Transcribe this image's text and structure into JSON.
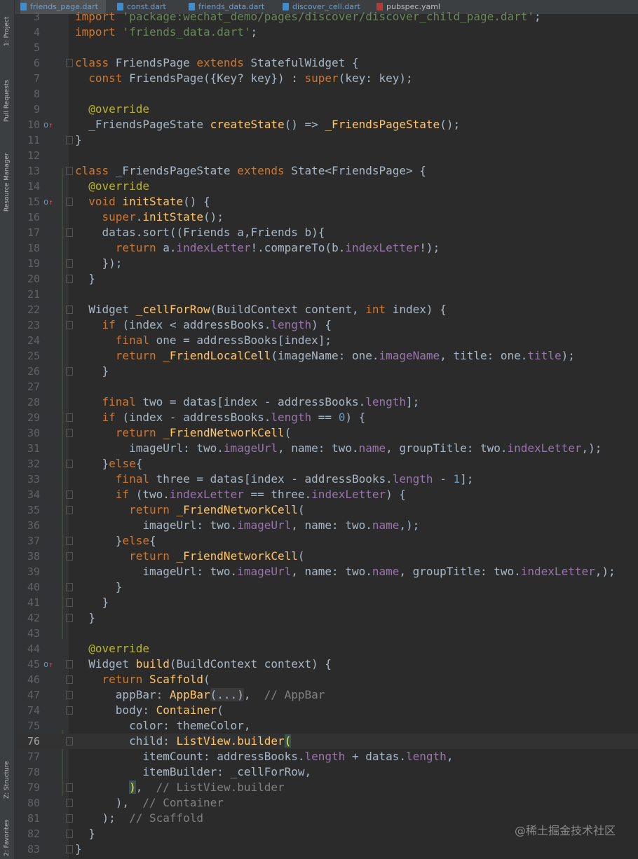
{
  "tabs": [
    {
      "label": "friends_page.dart"
    },
    {
      "label": "const.dart"
    },
    {
      "label": "friends_data.dart"
    },
    {
      "label": "discover_cell.dart"
    },
    {
      "label": "pubspec.yaml"
    }
  ],
  "sidebar": {
    "project": "1: Project",
    "pull_requests": "Pull Requests",
    "resource_manager": "Resource Manager",
    "structure": "Z: Structure",
    "favorites": "2: Favorites"
  },
  "current_line": "76",
  "watermark": "@稀土掘金技术社区",
  "colors": {
    "keyword": "#cc7832",
    "string": "#6a8759",
    "function": "#ffc66d",
    "annotation": "#bbb529",
    "property": "#9876aa",
    "number": "#6897bb",
    "comment": "#808080"
  },
  "lines": [
    {
      "n": "3",
      "html": "<span class=\"kw\">import </span><span class=\"str\">'package:wechat_demo/pages/discover/discover_child_page.dart'</span>;",
      "fold": false,
      "mark": false
    },
    {
      "n": "4",
      "html": "<span class=\"kw\">import </span><span class=\"str\">'friends_data.dart'</span>;",
      "fold": false,
      "mark": false
    },
    {
      "n": "5",
      "html": "",
      "fold": false,
      "mark": false
    },
    {
      "n": "6",
      "html": "<span class=\"kw\">class </span>FriendsPage <span class=\"kw\">extends </span>StatefulWidget {",
      "fold": true,
      "mark": false
    },
    {
      "n": "7",
      "html": "  <span class=\"kw\">const </span>FriendsPage({Key? key}) : <span class=\"kw\">super</span>(key: key);",
      "fold": false,
      "mark": false
    },
    {
      "n": "8",
      "html": "",
      "fold": false,
      "mark": false
    },
    {
      "n": "9",
      "html": "  <span class=\"ann\">@override</span>",
      "fold": false,
      "mark": false
    },
    {
      "n": "10",
      "html": "  _FriendsPageState <span class=\"fn\">createState</span>() =&gt; <span class=\"fn\">_FriendsPageState</span>();",
      "fold": false,
      "mark": true
    },
    {
      "n": "11",
      "html": "}",
      "fold": true,
      "mark": false
    },
    {
      "n": "12",
      "html": "",
      "fold": false,
      "mark": false
    },
    {
      "n": "13",
      "html": "<span class=\"kw\">class </span>_FriendsPageState <span class=\"kw\">extends </span>State&lt;FriendsPage&gt; {",
      "fold": true,
      "mark": false
    },
    {
      "n": "14",
      "html": "  <span class=\"ann\">@override</span>",
      "fold": false,
      "mark": false
    },
    {
      "n": "15",
      "html": "  <span class=\"kw\">void </span><span class=\"fn\">initState</span>() {",
      "fold": true,
      "mark": true
    },
    {
      "n": "16",
      "html": "    <span class=\"kw\">super</span>.<span class=\"fn\">initState</span>();",
      "fold": false,
      "mark": false
    },
    {
      "n": "17",
      "html": "    datas.sort((Friends a,Friends b){",
      "fold": true,
      "mark": false
    },
    {
      "n": "18",
      "html": "      <span class=\"kw\">return </span>a.<span class=\"prop\">indexLetter</span>!.compareTo(b.<span class=\"prop\">indexLetter</span>!);",
      "fold": false,
      "mark": false
    },
    {
      "n": "19",
      "html": "    });",
      "fold": true,
      "mark": false
    },
    {
      "n": "20",
      "html": "  }",
      "fold": true,
      "mark": false
    },
    {
      "n": "21",
      "html": "",
      "fold": false,
      "mark": false
    },
    {
      "n": "22",
      "html": "  Widget <span class=\"fn\">_cellForRow</span>(BuildContext content, <span class=\"kw\">int </span>index) {",
      "fold": true,
      "mark": false
    },
    {
      "n": "23",
      "html": "    <span class=\"kw\">if </span>(index &lt; addressBooks.<span class=\"prop\">length</span>) {",
      "fold": true,
      "mark": false
    },
    {
      "n": "24",
      "html": "      <span class=\"kw\">final </span>one = addressBooks[index];",
      "fold": false,
      "mark": false
    },
    {
      "n": "25",
      "html": "      <span class=\"kw\">return </span><span class=\"fn\">_FriendLocalCell</span>(imageName: one.<span class=\"prop\">imageName</span>, title: one.<span class=\"prop\">title</span>);",
      "fold": false,
      "mark": false
    },
    {
      "n": "26",
      "html": "    }",
      "fold": true,
      "mark": false
    },
    {
      "n": "27",
      "html": "",
      "fold": false,
      "mark": false
    },
    {
      "n": "28",
      "html": "    <span class=\"kw\">final </span>two = datas[index - addressBooks.<span class=\"prop\">length</span>];",
      "fold": false,
      "mark": false
    },
    {
      "n": "29",
      "html": "    <span class=\"kw\">if </span>(index - addressBooks.<span class=\"prop\">length </span>== <span class=\"num\">0</span>) {",
      "fold": true,
      "mark": false
    },
    {
      "n": "30",
      "html": "      <span class=\"kw\">return </span><span class=\"fn\">_FriendNetworkCell</span>(",
      "fold": true,
      "mark": false
    },
    {
      "n": "31",
      "html": "        imageUrl: two.<span class=\"prop\">imageUrl</span>, name: two.<span class=\"prop\">name</span>, groupTitle: two.<span class=\"prop\">indexLetter</span>,);",
      "fold": false,
      "mark": false
    },
    {
      "n": "32",
      "html": "    }<span class=\"kw\">else</span>{",
      "fold": true,
      "mark": false
    },
    {
      "n": "33",
      "html": "      <span class=\"kw\">final </span>three = datas[index - addressBooks.<span class=\"prop\">length </span>- <span class=\"num\">1</span>];",
      "fold": false,
      "mark": false
    },
    {
      "n": "34",
      "html": "      <span class=\"kw\">if </span>(two.<span class=\"prop\">indexLetter </span>== three.<span class=\"prop\">indexLetter</span>) {",
      "fold": true,
      "mark": false
    },
    {
      "n": "35",
      "html": "        <span class=\"kw\">return </span><span class=\"fn\">_FriendNetworkCell</span>(",
      "fold": true,
      "mark": false
    },
    {
      "n": "36",
      "html": "          imageUrl: two.<span class=\"prop\">imageUrl</span>, name: two.<span class=\"prop\">name</span>,);",
      "fold": false,
      "mark": false
    },
    {
      "n": "37",
      "html": "      }<span class=\"kw\">else</span>{",
      "fold": true,
      "mark": false
    },
    {
      "n": "38",
      "html": "        <span class=\"kw\">return </span><span class=\"fn\">_FriendNetworkCell</span>(",
      "fold": true,
      "mark": false
    },
    {
      "n": "39",
      "html": "          imageUrl: two.<span class=\"prop\">imageUrl</span>, name: two.<span class=\"prop\">name</span>, groupTitle: two.<span class=\"prop\">indexLetter</span>,);",
      "fold": false,
      "mark": false
    },
    {
      "n": "40",
      "html": "      }",
      "fold": true,
      "mark": false
    },
    {
      "n": "41",
      "html": "    }",
      "fold": true,
      "mark": false
    },
    {
      "n": "42",
      "html": "  }",
      "fold": true,
      "mark": false
    },
    {
      "n": "43",
      "html": "",
      "fold": false,
      "mark": false
    },
    {
      "n": "44",
      "html": "  <span class=\"ann\">@override</span>",
      "fold": false,
      "mark": false
    },
    {
      "n": "45",
      "html": "  Widget <span class=\"fn\">build</span>(BuildContext context) {",
      "fold": true,
      "mark": true
    },
    {
      "n": "46",
      "html": "    <span class=\"kw\">return </span><span class=\"fn\">Scaffold</span>(",
      "fold": true,
      "mark": false
    },
    {
      "n": "47",
      "html": "      appBar: <span class=\"fn\">AppBar</span><span class=\"fd\">(...)</span>,  <span class=\"cm\">// AppBar</span>",
      "fold": true,
      "mark": false
    },
    {
      "n": "74",
      "html": "      body: <span class=\"fn\">Container</span>(",
      "fold": true,
      "mark": false
    },
    {
      "n": "75",
      "html": "        color: themeColor,",
      "fold": false,
      "mark": false
    },
    {
      "n": "76",
      "html": "        child: <span class=\"fn\">ListView.builder</span><span class=\"br\">(</span>",
      "fold": true,
      "mark": false
    },
    {
      "n": "77",
      "html": "          itemCount: addressBooks.<span class=\"prop\">length </span>+ datas.<span class=\"prop\">length</span>,",
      "fold": false,
      "mark": false
    },
    {
      "n": "78",
      "html": "          itemBuilder: _cellForRow,",
      "fold": false,
      "mark": false
    },
    {
      "n": "79",
      "html": "        <span class=\"br\">)</span>,  <span class=\"cm\">// ListView.builder</span>",
      "fold": true,
      "mark": false
    },
    {
      "n": "80",
      "html": "      ),  <span class=\"cm\">// Container</span>",
      "fold": true,
      "mark": false
    },
    {
      "n": "81",
      "html": "    );  <span class=\"cm\">// Scaffold</span>",
      "fold": true,
      "mark": false
    },
    {
      "n": "82",
      "html": "  }",
      "fold": true,
      "mark": false
    },
    {
      "n": "83",
      "html": "}",
      "fold": true,
      "mark": false
    }
  ]
}
